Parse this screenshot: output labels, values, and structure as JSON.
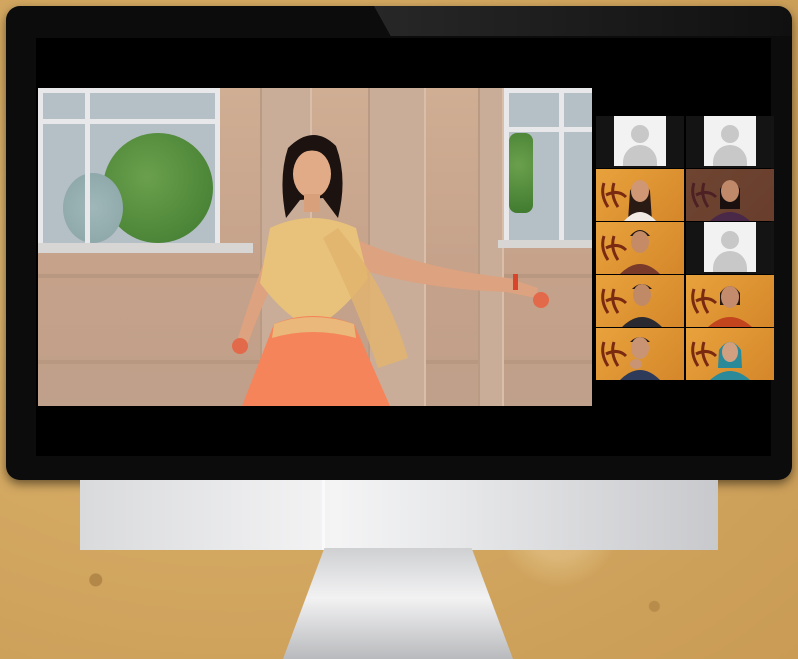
{
  "meeting": {
    "main_video": {
      "subject": "dancer"
    },
    "participants": [
      {
        "type": "blank"
      },
      {
        "type": "blank"
      },
      {
        "type": "camera"
      },
      {
        "type": "camera"
      },
      {
        "type": "camera"
      },
      {
        "type": "blank"
      },
      {
        "type": "camera"
      },
      {
        "type": "camera"
      },
      {
        "type": "camera"
      },
      {
        "type": "camera"
      }
    ]
  },
  "colors": {
    "tile_background": "#e09a35",
    "outfit_blouse": "#e8c27a",
    "outfit_skirt": "#f5845a",
    "frame": "#0c0c0c"
  }
}
